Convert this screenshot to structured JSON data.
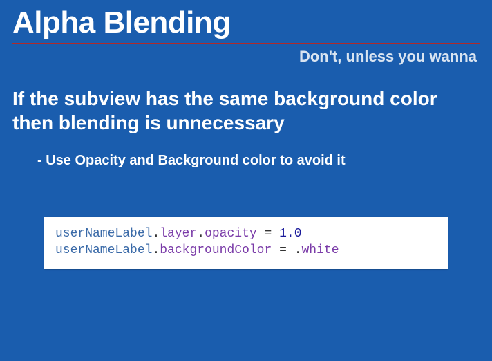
{
  "title": "Alpha Blending",
  "subtitle": "Don't, unless you wanna",
  "headline": "If the subview has the same background color then blending is unnecessary",
  "bullet": "- Use Opacity and Background color to avoid it",
  "code": {
    "line1": {
      "ident": "userNameLabel",
      "prop1": "layer",
      "prop2": "opacity",
      "op": " = ",
      "value": "1.0"
    },
    "line2": {
      "ident": "userNameLabel",
      "prop1": "backgroundColor",
      "op": " = ",
      "dot": ".",
      "value": "white"
    }
  }
}
